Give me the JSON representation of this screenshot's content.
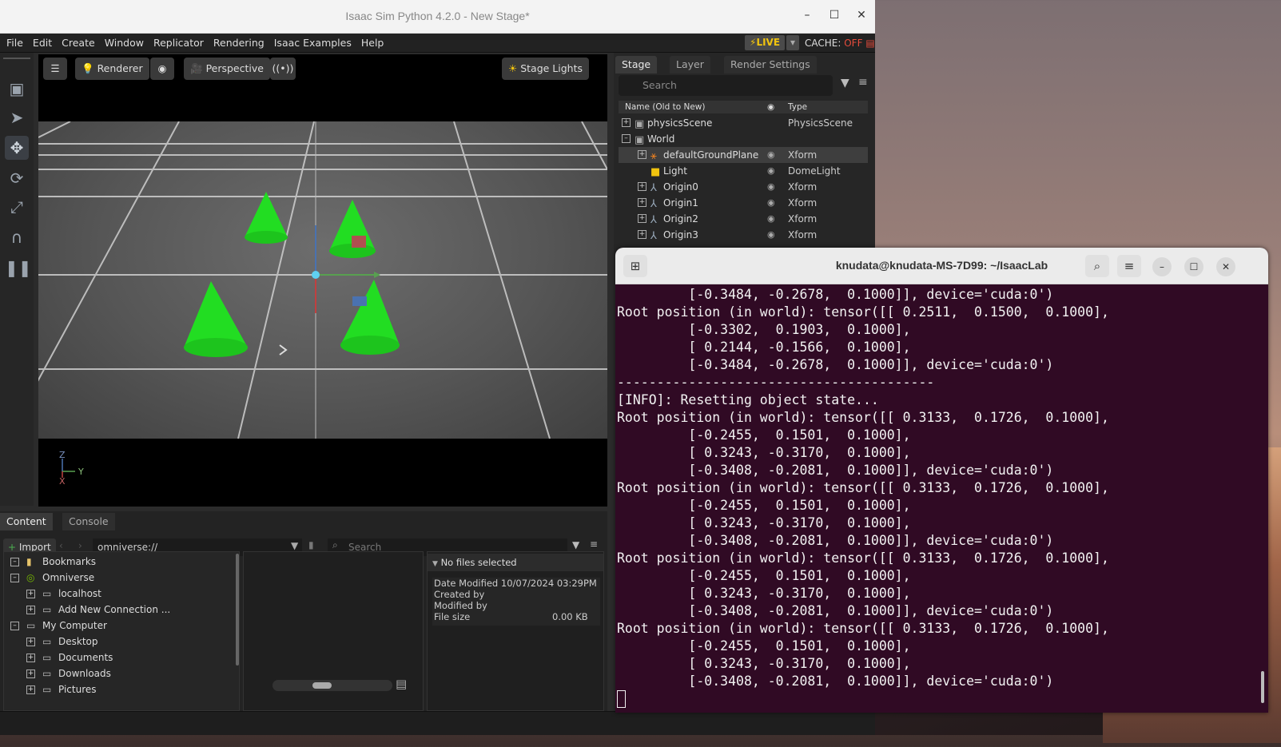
{
  "sim": {
    "title": "Isaac Sim Python 4.2.0 - New Stage*",
    "menu": [
      "File",
      "Edit",
      "Create",
      "Window",
      "Replicator",
      "Rendering",
      "Isaac Examples",
      "Help"
    ],
    "live": "LIVE",
    "cache_label": "CACHE:",
    "cache_value": "OFF"
  },
  "viewport": {
    "renderer": "Renderer",
    "camera": "Perspective",
    "stage_lights": "Stage Lights",
    "axis_z": "Z",
    "axis_y": "Y",
    "axis_x": "X"
  },
  "stage": {
    "tabs": [
      "Stage",
      "Layer",
      "Render Settings"
    ],
    "search_placeholder": "Search",
    "col_name": "Name (Old to New)",
    "col_type": "Type",
    "rows": [
      {
        "name": "physicsScene",
        "type": "PhysicsScene"
      },
      {
        "name": "World",
        "type": ""
      },
      {
        "name": "defaultGroundPlane",
        "type": "Xform"
      },
      {
        "name": "Light",
        "type": "DomeLight"
      },
      {
        "name": "Origin0",
        "type": "Xform"
      },
      {
        "name": "Origin1",
        "type": "Xform"
      },
      {
        "name": "Origin2",
        "type": "Xform"
      },
      {
        "name": "Origin3",
        "type": "Xform"
      }
    ]
  },
  "content": {
    "tabs": [
      "Content",
      "Console"
    ],
    "import": "Import",
    "path": "omniverse://",
    "search_placeholder": "Search",
    "tree": [
      "Bookmarks",
      "Omniverse",
      "localhost",
      "Add New Connection ...",
      "My Computer",
      "Desktop",
      "Documents",
      "Downloads",
      "Pictures"
    ],
    "no_files": "No files selected",
    "date_modified_label": "Date Modified",
    "date_modified_value": "10/07/2024 03:29PM",
    "created_by": "Created by",
    "modified_by": "Modified by",
    "file_size_label": "File size",
    "file_size_value": "0.00 KB"
  },
  "terminal": {
    "title": "knudata@knudata-MS-7D99: ~/IsaacLab",
    "lines": [
      "         [-0.3484, -0.2678,  0.1000]], device='cuda:0')",
      "Root position (in world): tensor([[ 0.2511,  0.1500,  0.1000],",
      "         [-0.3302,  0.1903,  0.1000],",
      "         [ 0.2144, -0.1566,  0.1000],",
      "         [-0.3484, -0.2678,  0.1000]], device='cuda:0')",
      "----------------------------------------",
      "[INFO]: Resetting object state...",
      "Root position (in world): tensor([[ 0.3133,  0.1726,  0.1000],",
      "         [-0.2455,  0.1501,  0.1000],",
      "         [ 0.3243, -0.3170,  0.1000],",
      "         [-0.3408, -0.2081,  0.1000]], device='cuda:0')",
      "Root position (in world): tensor([[ 0.3133,  0.1726,  0.1000],",
      "         [-0.2455,  0.1501,  0.1000],",
      "         [ 0.3243, -0.3170,  0.1000],",
      "         [-0.3408, -0.2081,  0.1000]], device='cuda:0')",
      "Root position (in world): tensor([[ 0.3133,  0.1726,  0.1000],",
      "         [-0.2455,  0.1501,  0.1000],",
      "         [ 0.3243, -0.3170,  0.1000],",
      "         [-0.3408, -0.2081,  0.1000]], device='cuda:0')",
      "Root position (in world): tensor([[ 0.3133,  0.1726,  0.1000],",
      "         [-0.2455,  0.1501,  0.1000],",
      "         [ 0.3243, -0.3170,  0.1000],",
      "         [-0.3408, -0.2081,  0.1000]], device='cuda:0')"
    ]
  },
  "colors": {
    "accent_live": "#f1c40f",
    "cache_off": "#e74c3c",
    "terminal_bg": "#300a24",
    "cone": "#22dd22"
  }
}
